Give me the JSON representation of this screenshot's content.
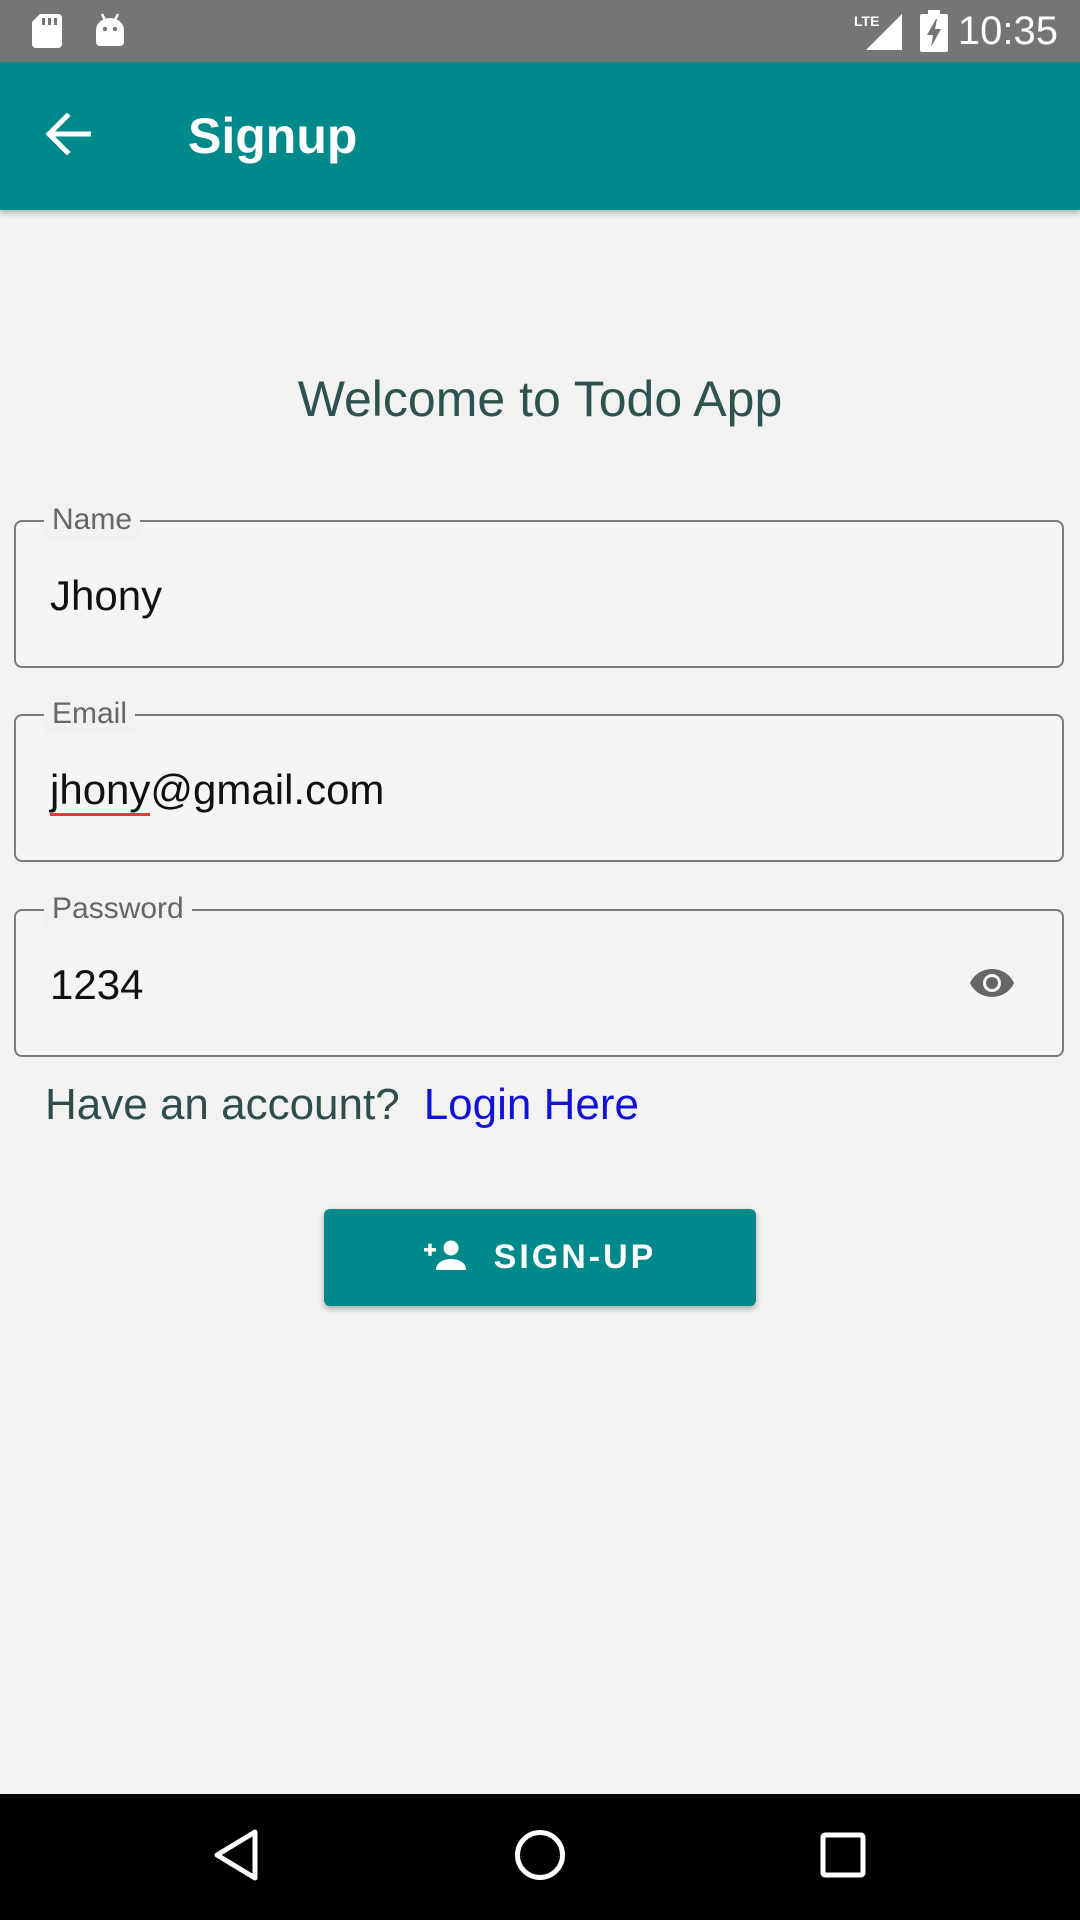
{
  "status_bar": {
    "time": "10:35",
    "network": "LTE",
    "icons": [
      "sd-card-icon",
      "android-icon",
      "lte-signal-icon",
      "battery-charging-icon"
    ]
  },
  "app_bar": {
    "title": "Signup",
    "back_icon": "arrow-left-icon"
  },
  "welcome_text": "Welcome to Todo App",
  "form": {
    "name": {
      "label": "Name",
      "value": "Jhony"
    },
    "email": {
      "label": "Email",
      "value_user": "jhony",
      "value_rest": "@gmail.com"
    },
    "password": {
      "label": "Password",
      "value": "1234",
      "toggle_icon": "eye-icon"
    }
  },
  "account_prompt": {
    "text": "Have an account?",
    "link": "Login Here"
  },
  "signup_button": {
    "label": "SIGN-UP",
    "icon": "person-add-icon"
  },
  "nav_bar": {
    "icons": [
      "back-triangle-icon",
      "home-circle-icon",
      "recents-square-icon"
    ]
  },
  "colors": {
    "primary": "#00898a",
    "status_bar": "#757575",
    "background": "#f2f2f2",
    "link": "#1212d6",
    "heading": "#2e5250"
  }
}
